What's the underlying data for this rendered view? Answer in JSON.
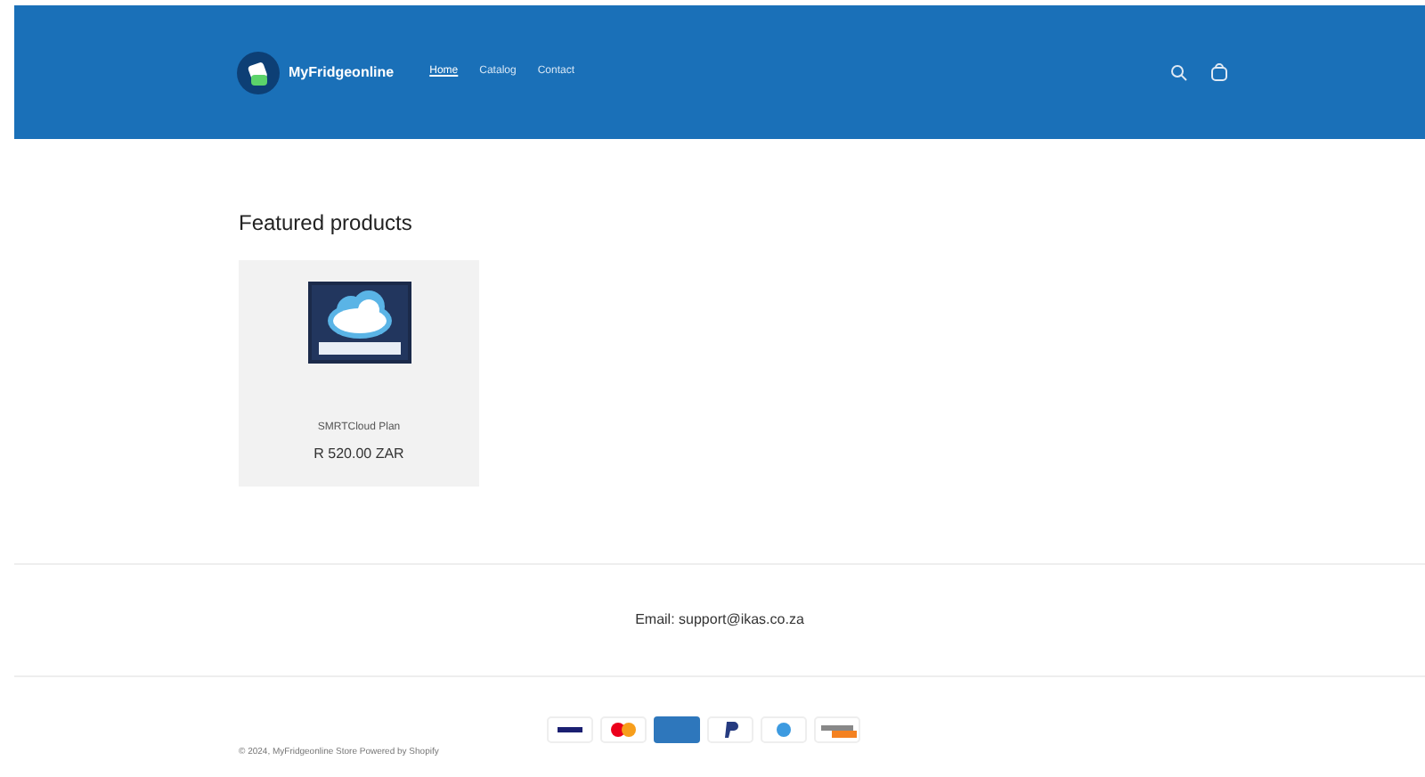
{
  "header": {
    "logo_text": "MyFridgeonline",
    "nav": [
      {
        "label": "Home",
        "selected": true
      },
      {
        "label": "Catalog",
        "selected": false
      },
      {
        "label": "Contact",
        "selected": false
      }
    ]
  },
  "featured": {
    "title": "Featured products",
    "products": [
      {
        "kind": "picture",
        "name": "SMRTCloud Plan",
        "price": "R 520.00 ZAR"
      }
    ]
  },
  "contact": {
    "text": "Email: support@ikas.co.za"
  },
  "footer": {
    "copyright": "© 2024, MyFridgeonline Store Powered by Shopify"
  }
}
